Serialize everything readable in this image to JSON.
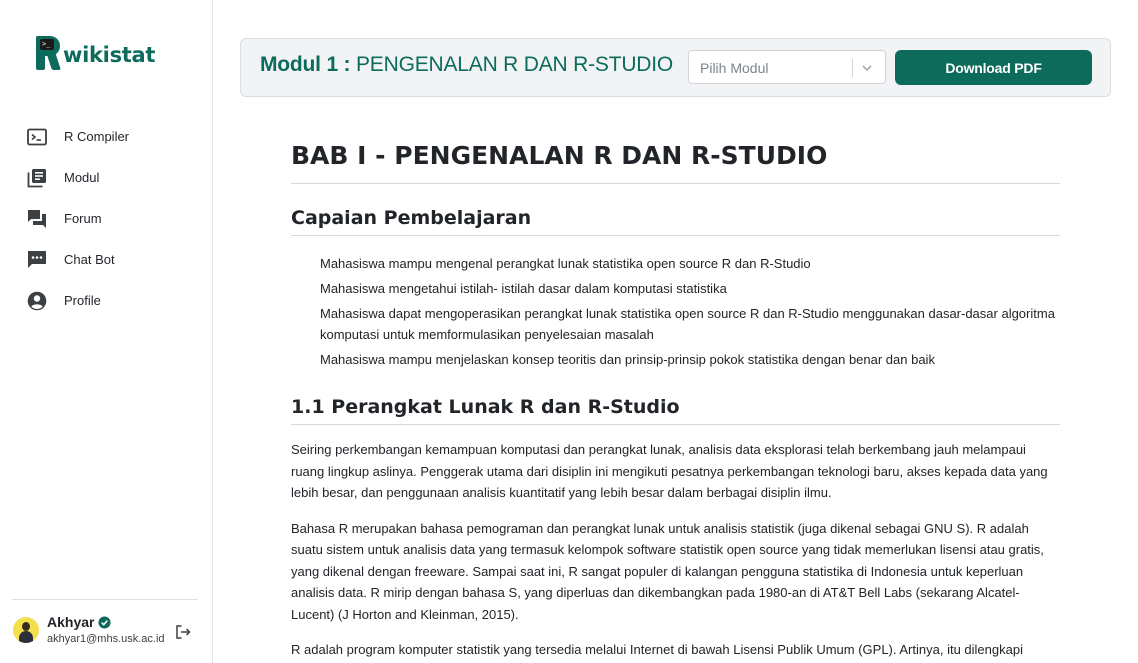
{
  "app": {
    "logo_text": "wikistat",
    "logo_glyph": ">_"
  },
  "sidebar": {
    "items": [
      {
        "label": "R Compiler",
        "icon": "terminal-icon"
      },
      {
        "label": "Modul",
        "icon": "library-books-icon"
      },
      {
        "label": "Forum",
        "icon": "forum-icon"
      },
      {
        "label": "Chat Bot",
        "icon": "chat-icon"
      },
      {
        "label": "Profile",
        "icon": "account-circle-icon"
      }
    ]
  },
  "user": {
    "name": "Akhyar",
    "email": "akhyar1@mhs.usk.ac.id"
  },
  "header": {
    "module_prefix": "Modul 1 :",
    "module_name": " PENGENALAN R DAN R-STUDIO",
    "select_placeholder": "Pilih Modul",
    "download_label": "Download PDF"
  },
  "colors": {
    "brand": "#0d6b5c"
  },
  "doc": {
    "chapter_title": "BAB I - PENGENALAN R DAN R-STUDIO",
    "section1_title": "Capaian Pembelajaran",
    "objectives": [
      "Mahasiswa mampu mengenal perangkat lunak statistika open source R dan R-Studio",
      "Mahasiswa mengetahui istilah- istilah dasar dalam komputasi statistika",
      "Mahasiswa dapat mengoperasikan perangkat lunak statistika open source R dan R-Studio menggunakan dasar-dasar algoritma komputasi untuk memformulasikan penyelesaian masalah",
      "Mahasiswa mampu menjelaskan konsep teoritis dan prinsip-prinsip pokok statistika dengan benar dan baik"
    ],
    "section2_title": "1.1 Perangkat Lunak R dan R-Studio",
    "paragraphs": [
      "Seiring perkembangan kemampuan komputasi dan perangkat lunak, analisis data eksplorasi telah berkembang jauh melampaui ruang lingkup aslinya. Penggerak utama dari disiplin ini mengikuti pesatnya perkembangan teknologi baru, akses kepada data yang lebih besar, dan penggunaan analisis kuantitatif yang lebih besar dalam berbagai disiplin ilmu.",
      "Bahasa R merupakan bahasa pemograman dan perangkat lunak untuk analisis statistik (juga dikenal sebagai GNU S). R adalah suatu sistem untuk analisis data yang termasuk kelompok software statistik open source yang tidak memerlukan lisensi atau gratis, yang dikenal dengan freeware. Sampai saat ini, R sangat populer di kalangan pengguna statistika di Indonesia untuk keperluan analisis data. R mirip dengan bahasa S, yang diperluas dan dikembangkan pada 1980-an di AT&T Bell Labs (sekarang Alcatel-Lucent) (J Horton and Kleinman, 2015).",
      "R adalah program komputer statistik yang tersedia melalui Internet di bawah Lisensi Publik Umum (GPL). Artinya, itu dilengkapi"
    ]
  }
}
